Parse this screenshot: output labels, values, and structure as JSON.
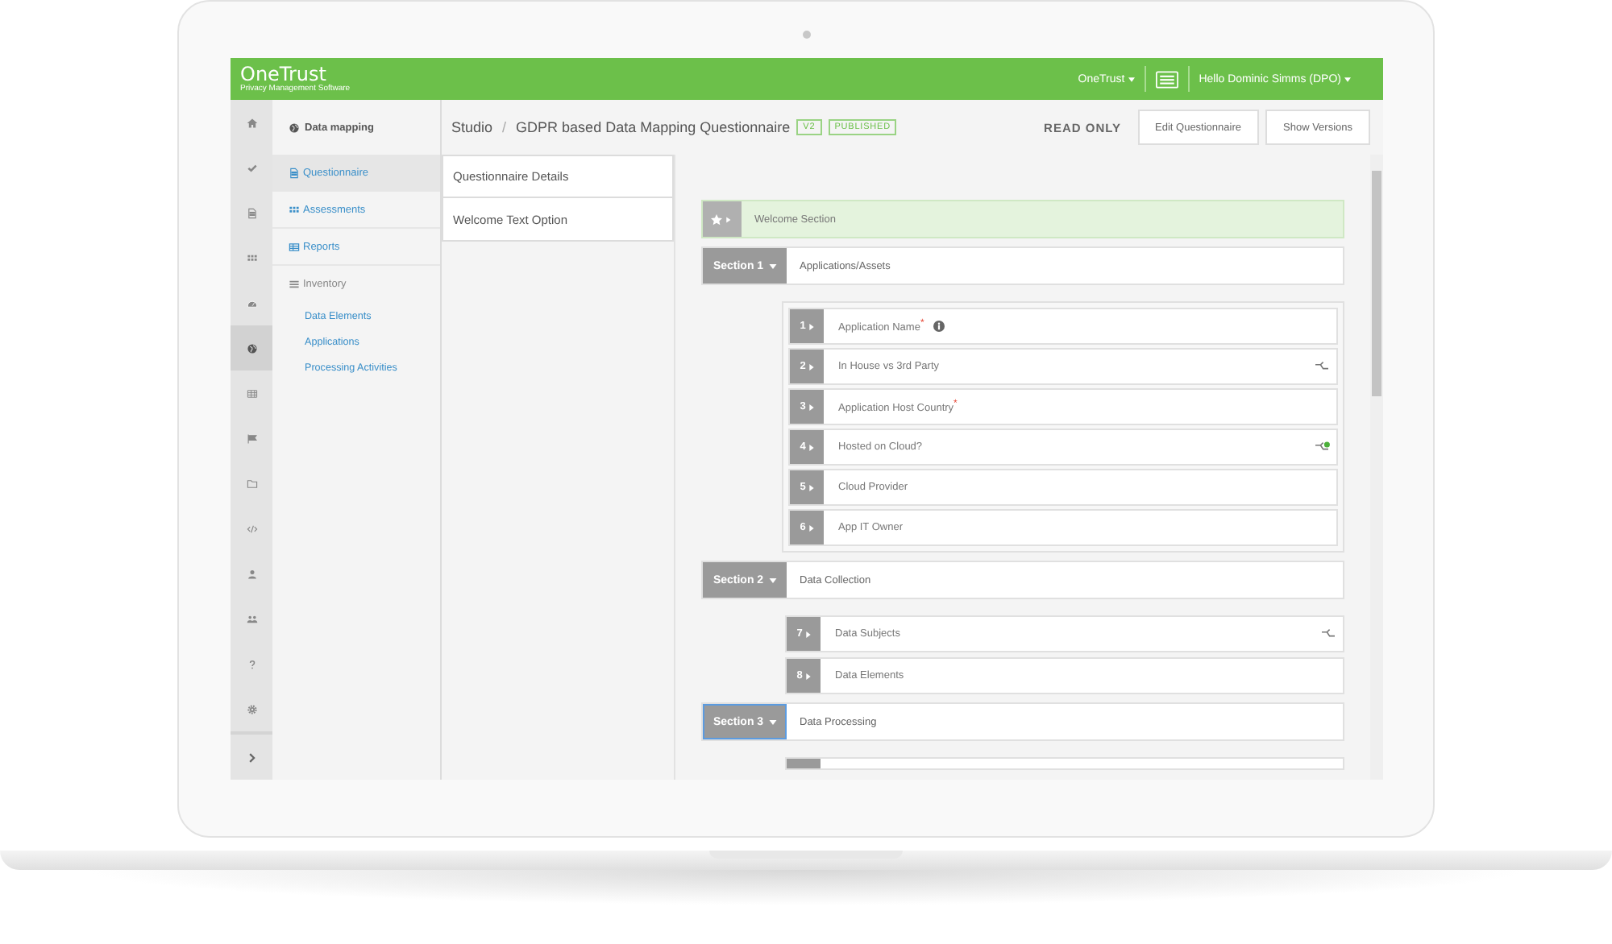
{
  "header": {
    "logo": "OneTrust",
    "tagline": "Privacy Management Software",
    "org_menu": "OneTrust",
    "user_menu": "Hello Dominic Simms (DPO)"
  },
  "rail": [
    {
      "selected": false
    },
    {
      "selected": false
    },
    {
      "selected": false
    },
    {
      "selected": false
    },
    {
      "selected": false
    },
    {
      "selected": true
    },
    {
      "selected": false
    },
    {
      "selected": false
    },
    {
      "selected": false
    },
    {
      "selected": false
    },
    {
      "selected": false
    },
    {
      "selected": false
    },
    {
      "selected": false
    },
    {
      "selected": false
    }
  ],
  "nav": {
    "title": "Data mapping",
    "items": [
      {
        "label": "Questionnaire",
        "kind": "link",
        "selected": true
      },
      {
        "label": "Assessments",
        "kind": "link",
        "selected": false
      },
      {
        "label": "Reports",
        "kind": "link",
        "selected": false
      },
      {
        "label": "Inventory",
        "kind": "heading",
        "selected": false
      },
      {
        "label": "Data Elements",
        "kind": "sub",
        "selected": false
      },
      {
        "label": "Applications",
        "kind": "sub",
        "selected": false
      },
      {
        "label": "Processing Activities",
        "kind": "sub",
        "selected": false
      }
    ]
  },
  "breadcrumb": {
    "root": "Studio",
    "separator": "/",
    "title": "GDPR based Data Mapping Questionnaire",
    "badges": [
      "V2",
      "PUBLISHED"
    ]
  },
  "status": "READ ONLY",
  "buttons": [
    "Edit Questionnaire",
    "Show Versions"
  ],
  "side_tabs": [
    "Questionnaire Details",
    "Welcome Text Option"
  ],
  "welcome": "Welcome Section",
  "sections": [
    {
      "label": "Section 1",
      "title": "Applications/Assets",
      "focused": false,
      "questions": [
        {
          "number": "1",
          "text": "Application Name$^{*}$",
          "info": true,
          "logic": false,
          "logic_active": false
        },
        {
          "number": "2",
          "text": "In House vs 3rd Party",
          "info": false,
          "logic": true,
          "logic_active": false
        },
        {
          "number": "3",
          "text": "Application Host Country$^{*}$",
          "info": false,
          "logic": false,
          "logic_active": false
        },
        {
          "number": "4",
          "text": "Hosted on Cloud?",
          "info": false,
          "logic": true,
          "logic_active": true
        },
        {
          "number": "5",
          "text": "Cloud Provider",
          "info": false,
          "logic": false,
          "logic_active": false
        },
        {
          "number": "6",
          "text": "App IT Owner",
          "info": false,
          "logic": false,
          "logic_active": false
        }
      ]
    },
    {
      "label": "Section 2",
      "title": "Data Collection",
      "focused": false,
      "questions": [
        {
          "number": "7",
          "text": "Data Subjects",
          "info": false,
          "logic": true,
          "logic_active": false
        },
        {
          "number": "8",
          "text": "Data Elements",
          "info": false,
          "logic": false,
          "logic_active": false
        }
      ]
    },
    {
      "label": "Section 3",
      "title": "Data Processing",
      "focused": true
    }
  ]
}
